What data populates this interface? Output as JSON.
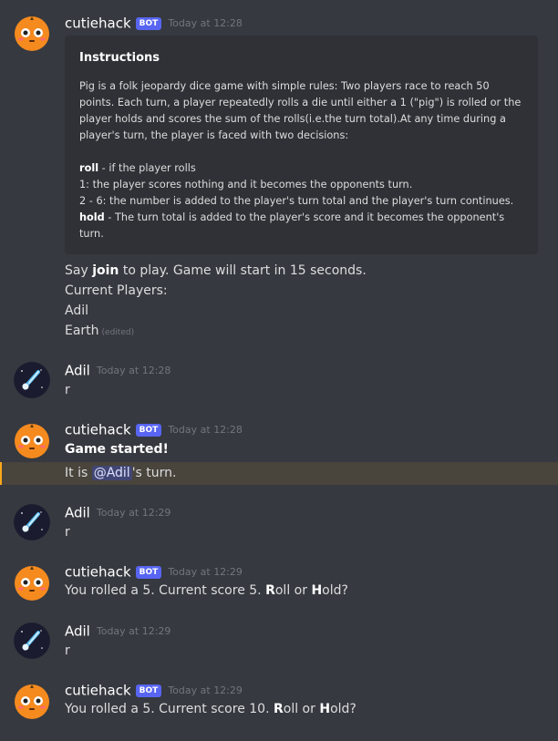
{
  "messages": {
    "m1": {
      "username": "cutiehack",
      "bot_tag": "BOT",
      "timestamp": "Today at 12:28",
      "embed": {
        "title": "Instructions",
        "para": [
          "Pig is a folk jeopardy dice game with simple rules: Two players race to reach 50",
          "points. Each turn, a player repeatedly rolls a die until either a 1 (\"pig\") is rolled or the",
          "player holds and scores the sum of the rolls(i.e.the turn total).At any time during a",
          "player's turn, the player is faced with two decisions:"
        ],
        "roll_keyword": "roll",
        "roll_desc": " - if the player rolls",
        "rule1": "1: the player scores nothing and it becomes the opponents turn.",
        "rule2": "2 - 6: the number is added to the player's turn total and the player's turn continues.",
        "hold_keyword": "hold",
        "hold_desc": " - The turn total is added to the player's score and it becomes the opponent's",
        "hold_desc2": "turn."
      },
      "say_prefix": "Say ",
      "say_keyword": "join",
      "say_suffix": " to play. Game will start in 15 seconds.",
      "current_players": "Current Players:",
      "player1": "Adil",
      "player2": "Earth",
      "edited": "(edited)"
    },
    "m2": {
      "username": "Adil",
      "timestamp": "Today at 12:28",
      "text": "r"
    },
    "m3": {
      "username": "cutiehack",
      "bot_tag": "BOT",
      "timestamp": "Today at 12:28",
      "text": "Game started!",
      "turn_prefix": "It is ",
      "mention": "@Adil",
      "turn_suffix": "'s turn."
    },
    "m4": {
      "username": "Adil",
      "timestamp": "Today at 12:29",
      "text": "r"
    },
    "m5": {
      "username": "cutiehack",
      "bot_tag": "BOT",
      "timestamp": "Today at 12:29",
      "text_prefix": "You rolled a 5. Current score 5. ",
      "r": "R",
      "oll_or": "oll or ",
      "h": "H",
      "old": "old?"
    },
    "m6": {
      "username": "Adil",
      "timestamp": "Today at 12:29",
      "text": "r"
    },
    "m7": {
      "username": "cutiehack",
      "bot_tag": "BOT",
      "timestamp": "Today at 12:29",
      "text_prefix": "You rolled a 5. Current score 10. ",
      "r": "R",
      "oll_or": "oll or ",
      "h": "H",
      "old": "old?"
    }
  },
  "colors": {
    "background": "#36393f",
    "embed_bg": "#2f3136",
    "bot_tag": "#5865f2",
    "highlight_bg": "#49443c",
    "highlight_bar": "#faa81a",
    "mention_bg": "#414675"
  },
  "icons": {
    "bot_avatar": "orange-pumpkin-face-icon",
    "user_avatar": "comet-icon"
  }
}
